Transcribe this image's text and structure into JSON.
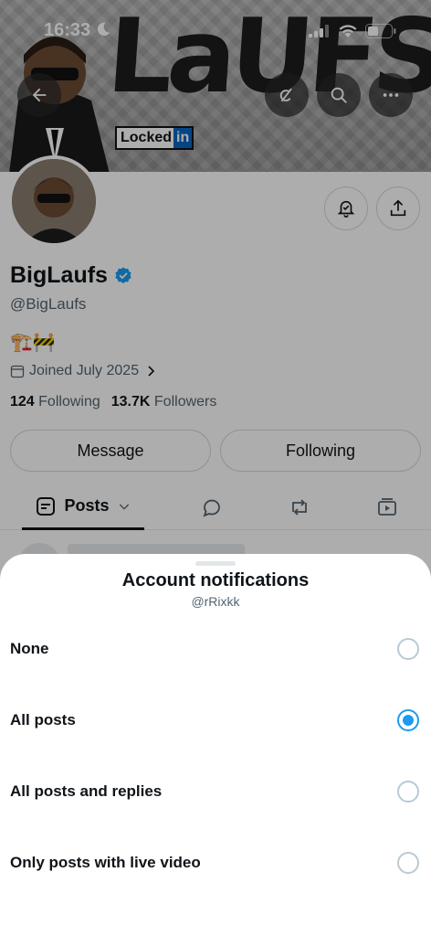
{
  "status_bar": {
    "time": "16:33"
  },
  "banner": {
    "title_text": "LaUFS",
    "badge_text": "Locked",
    "badge_in": "in"
  },
  "profile": {
    "display_name": "BigLaufs",
    "handle": "@BigLaufs",
    "bio": "🏗️🚧",
    "joined": "Joined July 2025",
    "following_count": "124",
    "following_label": "Following",
    "followers_count": "13.7K",
    "followers_label": "Followers"
  },
  "actions": {
    "message_label": "Message",
    "following_label": "Following"
  },
  "tabs": {
    "posts_label": "Posts"
  },
  "sheet": {
    "title": "Account notifications",
    "subtitle": "@rRixkk",
    "options": [
      {
        "label": "None",
        "selected": false
      },
      {
        "label": "All posts",
        "selected": true
      },
      {
        "label": "All posts and replies",
        "selected": false
      },
      {
        "label": "Only posts with live video",
        "selected": false
      }
    ]
  },
  "colors": {
    "accent": "#1d9bf0",
    "text": "#0f1419",
    "secondary": "#536471"
  }
}
